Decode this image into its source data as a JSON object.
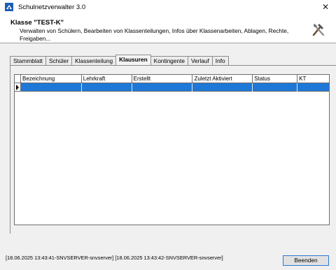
{
  "window": {
    "title": "Schulnetzverwalter 3.0",
    "close_glyph": "✕"
  },
  "header": {
    "title": "Klasse \"TEST-K\"",
    "description": "Verwalten von Schülern, Bearbeiten von Klassenteilungen, Infos über Klassenarbeiten, Ablagen, Rechte, Freigaben...",
    "icon": "tools-icon"
  },
  "tabs": [
    {
      "label": "Stammblatt",
      "active": false
    },
    {
      "label": "Schüler",
      "active": false
    },
    {
      "label": "Klassenteilung",
      "active": false
    },
    {
      "label": "Klausuren",
      "active": true
    },
    {
      "label": "Kontingente",
      "active": false
    },
    {
      "label": "Verlauf",
      "active": false
    },
    {
      "label": "Info",
      "active": false
    }
  ],
  "grid": {
    "columns": [
      "Bezeichnung",
      "Lehrkraft",
      "Erstellt",
      "Zuletzt Aktiviert",
      "Status",
      "KT"
    ],
    "rows": [
      [
        "",
        "",
        "",
        "",
        "",
        ""
      ]
    ],
    "selected_row": 0,
    "selection_color": "#1e78d7"
  },
  "status": {
    "text": "[18.06.2025 13:43:41-SNVSERVER-snvserver] [18.06.2025 13:43:42-SNVSERVER-snvserver]"
  },
  "footer": {
    "close_button_label": "Beenden"
  }
}
